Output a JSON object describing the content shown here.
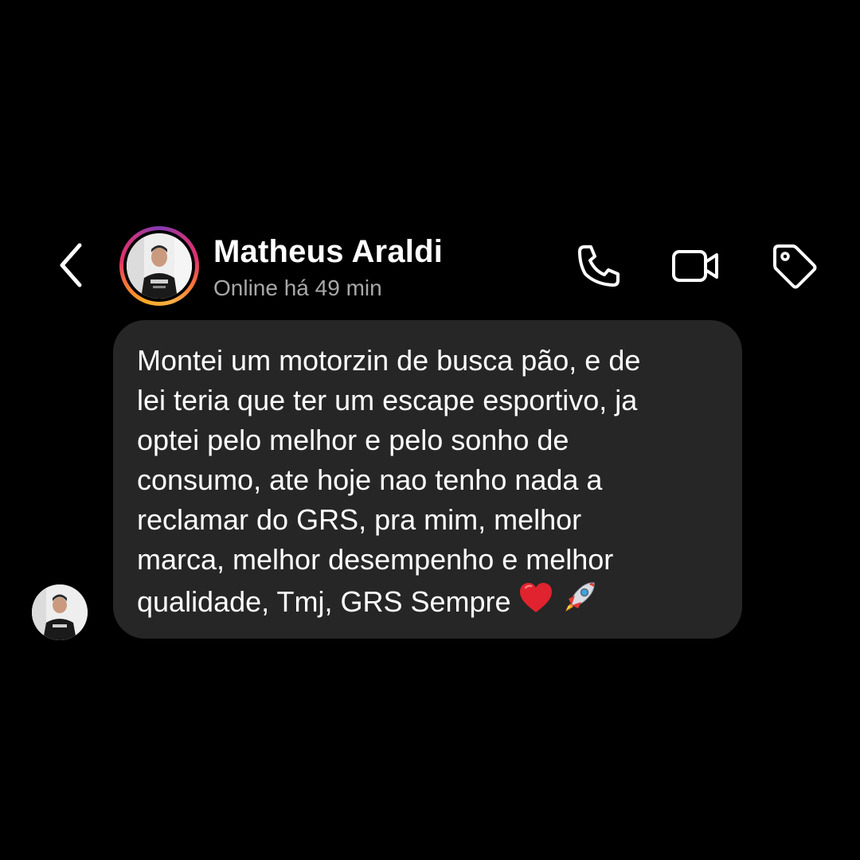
{
  "header": {
    "back_icon": "chevron-left-icon",
    "contact_name": "Matheus Araldi",
    "status": "Online há 49 min",
    "story_ring_colors": [
      "#fcaf45",
      "#f77737",
      "#e1306c",
      "#c13584",
      "#833ab4"
    ],
    "actions": {
      "call_icon": "phone-icon",
      "video_icon": "video-camera-icon",
      "tag_icon": "tag-icon"
    }
  },
  "conversation": {
    "messages": [
      {
        "sender": "Matheus Araldi",
        "text": "Montei um motorzin de busca pão, e de\nlei teria que ter um escape esportivo, ja\noptei pelo melhor e pelo sonho de\nconsumo, ate hoje nao tenho nada a\nreclamar do GRS, pra mim, melhor\nmarca, melhor desempenho e melhor\nqualidade, Tmj, GRS Sempre",
        "emojis": [
          "red-heart-emoji",
          "rocket-emoji"
        ]
      }
    ]
  },
  "colors": {
    "background": "#000000",
    "bubble": "#262626",
    "text": "#ffffff",
    "status_text": "#a8a8a8"
  }
}
